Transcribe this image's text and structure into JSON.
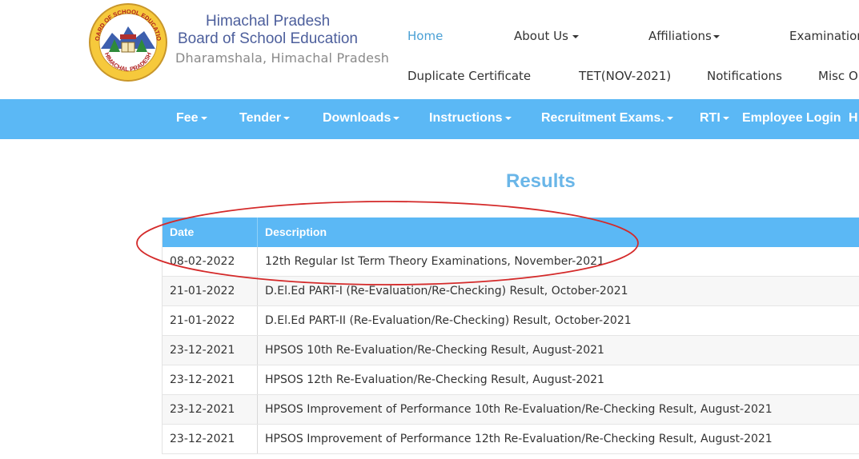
{
  "brand": {
    "line1": "Himachal Pradesh",
    "line2": "Board of School Education",
    "subtitle": "Dharamshala, Himachal Pradesh",
    "logo_ring_text": "BOARD OF SCHOOL EDUCATION",
    "logo_bottom_text": "HIMACHAL PRADESH"
  },
  "topnav": {
    "home": "Home",
    "about": "About Us",
    "affiliations": "Affiliations",
    "examinations": "Examinations",
    "duplicate": "Duplicate Certificate",
    "tet": "TET(NOV-2021)",
    "notifications": "Notifications",
    "misc": "Misc Or"
  },
  "bluebar": {
    "fee": "Fee",
    "tender": "Tender",
    "downloads": "Downloads",
    "instructions": "Instructions",
    "recruitment": "Recruitment Exams.",
    "rti": "RTI",
    "employee_login": "Employee Login",
    "more": "H"
  },
  "results": {
    "title": "Results",
    "headers": {
      "date": "Date",
      "description": "Description"
    },
    "rows": [
      {
        "date": "08-02-2022",
        "description": "12th Regular Ist Term Theory Examinations, November-2021"
      },
      {
        "date": "21-01-2022",
        "description": "D.El.Ed PART-I (Re-Evaluation/Re-Checking) Result, October-2021"
      },
      {
        "date": "21-01-2022",
        "description": "D.El.Ed PART-II (Re-Evaluation/Re-Checking) Result, October-2021"
      },
      {
        "date": "23-12-2021",
        "description": "HPSOS 10th Re-Evaluation/Re-Checking Result, August-2021"
      },
      {
        "date": "23-12-2021",
        "description": "HPSOS 12th Re-Evaluation/Re-Checking Result, August-2021"
      },
      {
        "date": "23-12-2021",
        "description": "HPSOS Improvement of Performance 10th Re-Evaluation/Re-Checking Result, August-2021"
      },
      {
        "date": "23-12-2021",
        "description": "HPSOS Improvement of Performance 12th Re-Evaluation/Re-Checking Result, August-2021"
      }
    ]
  },
  "colors": {
    "accent_blue": "#5bb8f5",
    "title_blue": "#6ab6e8",
    "brand_navy": "#4d5f9c",
    "annotation_red": "#d42a2a"
  }
}
